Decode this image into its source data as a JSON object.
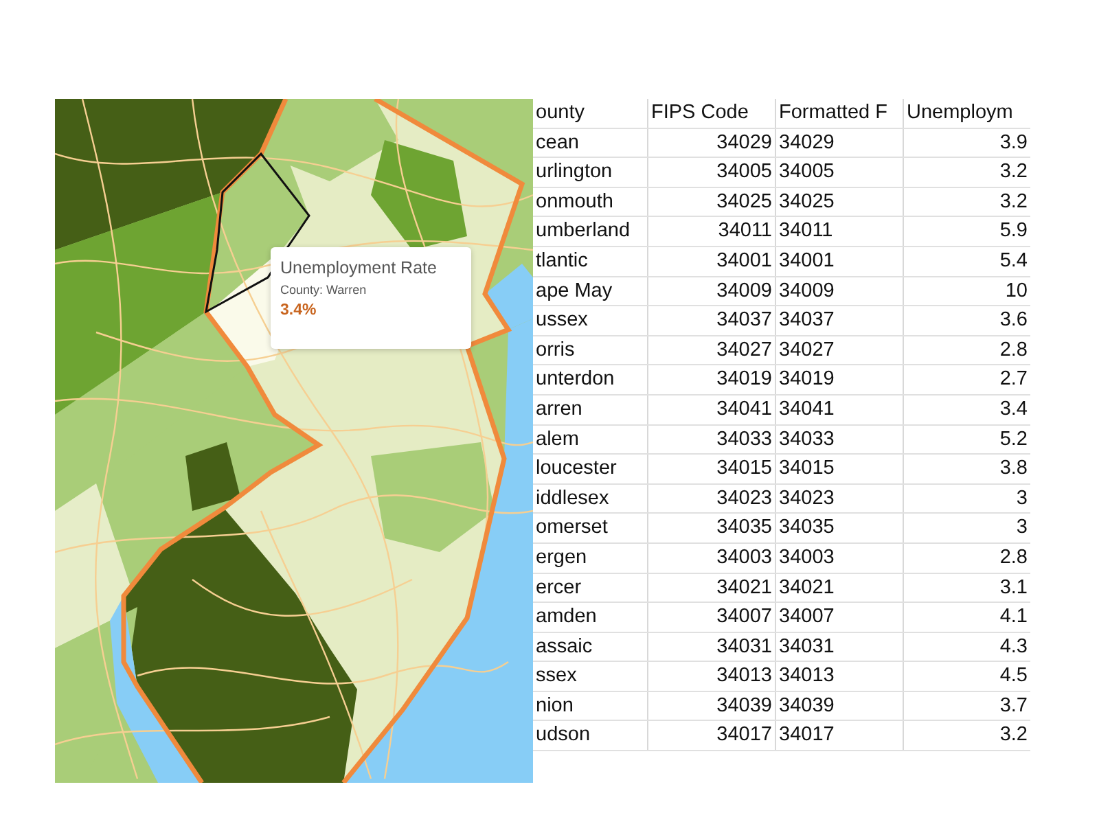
{
  "map": {
    "tooltip": {
      "title": "Unemployment Rate",
      "county_label": "County: Warren",
      "value": "3.4%"
    }
  },
  "table": {
    "columns": [
      "ounty",
      "FIPS Code",
      "Formatted F",
      "Unemploym"
    ],
    "rows": [
      {
        "county": "cean",
        "fips": "34029",
        "formatted": "34029",
        "unemployment": "3.9"
      },
      {
        "county": "urlington",
        "fips": "34005",
        "formatted": "34005",
        "unemployment": "3.2"
      },
      {
        "county": "onmouth",
        "fips": "34025",
        "formatted": "34025",
        "unemployment": "3.2"
      },
      {
        "county": "umberland",
        "fips": "34011",
        "formatted": "34011",
        "unemployment": "5.9"
      },
      {
        "county": "tlantic",
        "fips": "34001",
        "formatted": "34001",
        "unemployment": "5.4"
      },
      {
        "county": "ape May",
        "fips": "34009",
        "formatted": "34009",
        "unemployment": "10"
      },
      {
        "county": "ussex",
        "fips": "34037",
        "formatted": "34037",
        "unemployment": "3.6"
      },
      {
        "county": "orris",
        "fips": "34027",
        "formatted": "34027",
        "unemployment": "2.8"
      },
      {
        "county": "unterdon",
        "fips": "34019",
        "formatted": "34019",
        "unemployment": "2.7"
      },
      {
        "county": "arren",
        "fips": "34041",
        "formatted": "34041",
        "unemployment": "3.4"
      },
      {
        "county": "alem",
        "fips": "34033",
        "formatted": "34033",
        "unemployment": "5.2"
      },
      {
        "county": "loucester",
        "fips": "34015",
        "formatted": "34015",
        "unemployment": "3.8"
      },
      {
        "county": "iddlesex",
        "fips": "34023",
        "formatted": "34023",
        "unemployment": "3"
      },
      {
        "county": "omerset",
        "fips": "34035",
        "formatted": "34035",
        "unemployment": "3"
      },
      {
        "county": "ergen",
        "fips": "34003",
        "formatted": "34003",
        "unemployment": "2.8"
      },
      {
        "county": "ercer",
        "fips": "34021",
        "formatted": "34021",
        "unemployment": "3.1"
      },
      {
        "county": "amden",
        "fips": "34007",
        "formatted": "34007",
        "unemployment": "4.1"
      },
      {
        "county": "assaic",
        "fips": "34031",
        "formatted": "34031",
        "unemployment": "4.3"
      },
      {
        "county": "ssex",
        "fips": "34013",
        "formatted": "34013",
        "unemployment": "4.5"
      },
      {
        "county": "nion",
        "fips": "34039",
        "formatted": "34039",
        "unemployment": "3.7"
      },
      {
        "county": "udson",
        "fips": "34017",
        "formatted": "34017",
        "unemployment": "3.2"
      }
    ]
  }
}
